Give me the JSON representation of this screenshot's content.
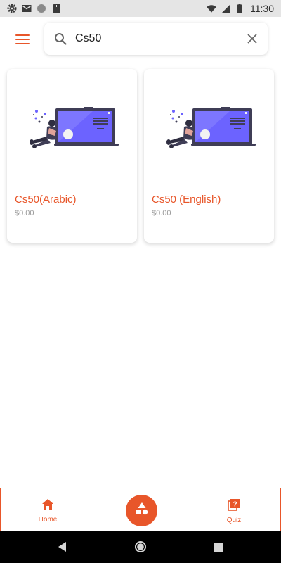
{
  "status_bar": {
    "time": "11:30",
    "icons": [
      "settings-icon",
      "gmail-icon",
      "circle-icon",
      "sd-card-icon",
      "wifi-icon",
      "signal-icon",
      "battery-icon"
    ]
  },
  "search": {
    "value": "Cs50",
    "placeholder": "Search"
  },
  "courses": [
    {
      "title": "Cs50(Arabic)",
      "price": "$0.00"
    },
    {
      "title": "Cs50 (English)",
      "price": "$0.00"
    }
  ],
  "bottom_nav": {
    "home_label": "Home",
    "quiz_label": "Quiz",
    "center_icon": "shapes-icon"
  },
  "colors": {
    "accent": "#e8562a",
    "illustration_purple": "#6c63ff",
    "status_bar_bg": "#e5e5e5"
  }
}
